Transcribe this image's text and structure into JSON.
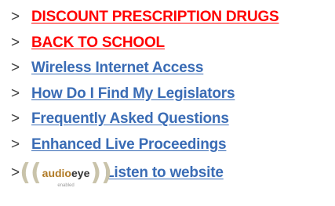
{
  "links": [
    {
      "label": "DISCOUNT PRESCRIPTION DRUGS",
      "color": "#ff0000"
    },
    {
      "label": "BACK TO SCHOOL",
      "color": "#ff0000"
    },
    {
      "label": "Wireless Internet Access",
      "color": "#3a6cb5"
    },
    {
      "label": "How Do I Find My Legislators",
      "color": "#3a6cb5"
    },
    {
      "label": "Frequently Asked Questions",
      "color": "#3a6cb5"
    },
    {
      "label": "Enhanced Live Proceedings",
      "color": "#3a6cb5"
    }
  ],
  "arrow_glyph": ">",
  "audioeye": {
    "logo_audio": "audio",
    "logo_eye": "eye",
    "logo_sub": "enabled",
    "link_label": "Listen to website",
    "link_color": "#3a6cb5"
  }
}
